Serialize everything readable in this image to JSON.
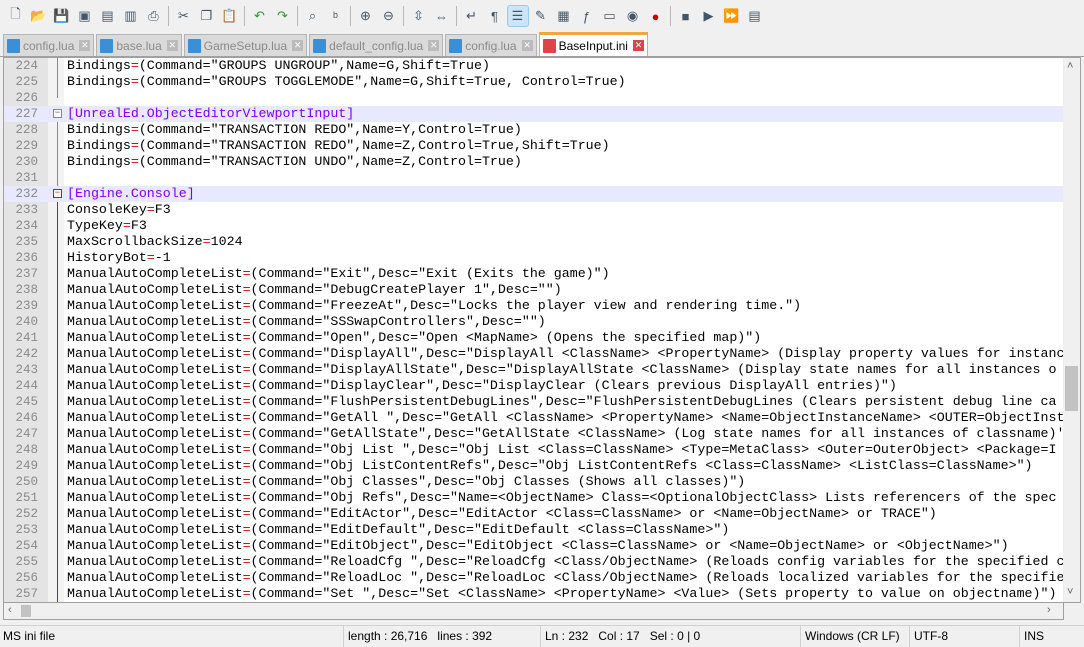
{
  "toolbar": {
    "icons": [
      "new-file",
      "open-file",
      "save",
      "save-all",
      "close",
      "close-all",
      "print",
      "cut",
      "copy",
      "paste",
      "undo",
      "redo",
      "find",
      "replace",
      "zoom-in",
      "zoom-out",
      "sync-vertical",
      "sync-horizontal",
      "word-wrap",
      "show-all-chars",
      "indent-guide",
      "user-defined-lang",
      "doc-map",
      "function-list",
      "folder-workspace",
      "monitor",
      "record-macro",
      "stop-macro",
      "play-macro",
      "run-macro-multiple",
      "save-macro"
    ]
  },
  "tabs": [
    {
      "label": "config.lua"
    },
    {
      "label": "base.lua"
    },
    {
      "label": "GameSetup.lua"
    },
    {
      "label": "default_config.lua"
    },
    {
      "label": "config.lua"
    },
    {
      "label": "BaseInput.ini",
      "active": true
    }
  ],
  "editor": {
    "lines": [
      {
        "n": "224",
        "t": "Bindings=(Command=\"GROUPS UNGROUP\",Name=G,Shift=True)"
      },
      {
        "n": "225",
        "t": "Bindings=(Command=\"GROUPS TOGGLEMODE\",Name=G,Shift=True, Control=True)"
      },
      {
        "n": "226",
        "t": ""
      },
      {
        "n": "227",
        "t": "[UnrealEd.ObjectEditorViewportInput]"
      },
      {
        "n": "228",
        "t": "Bindings=(Command=\"TRANSACTION REDO\",Name=Y,Control=True)"
      },
      {
        "n": "229",
        "t": "Bindings=(Command=\"TRANSACTION REDO\",Name=Z,Control=True,Shift=True)"
      },
      {
        "n": "230",
        "t": "Bindings=(Command=\"TRANSACTION UNDO\",Name=Z,Control=True)"
      },
      {
        "n": "231",
        "t": ""
      },
      {
        "n": "232",
        "t": "[Engine.Console]"
      },
      {
        "n": "233",
        "t": "ConsoleKey=F3"
      },
      {
        "n": "234",
        "t": "TypeKey=F3"
      },
      {
        "n": "235",
        "t": "MaxScrollbackSize=1024"
      },
      {
        "n": "236",
        "t": "HistoryBot=-1"
      },
      {
        "n": "237",
        "t": "ManualAutoCompleteList=(Command=\"Exit\",Desc=\"Exit (Exits the game)\")"
      },
      {
        "n": "238",
        "t": "ManualAutoCompleteList=(Command=\"DebugCreatePlayer 1\",Desc=\"\")"
      },
      {
        "n": "239",
        "t": "ManualAutoCompleteList=(Command=\"FreezeAt\",Desc=\"Locks the player view and rendering time.\")"
      },
      {
        "n": "240",
        "t": "ManualAutoCompleteList=(Command=\"SSSwapControllers\",Desc=\"\")"
      },
      {
        "n": "241",
        "t": "ManualAutoCompleteList=(Command=\"Open\",Desc=\"Open <MapName> (Opens the specified map)\")"
      },
      {
        "n": "242",
        "t": "ManualAutoCompleteList=(Command=\"DisplayAll\",Desc=\"DisplayAll <ClassName> <PropertyName> (Display property values for instanc"
      },
      {
        "n": "243",
        "t": "ManualAutoCompleteList=(Command=\"DisplayAllState\",Desc=\"DisplayAllState <ClassName> (Display state names for all instances o"
      },
      {
        "n": "244",
        "t": "ManualAutoCompleteList=(Command=\"DisplayClear\",Desc=\"DisplayClear (Clears previous DisplayAll entries)\")"
      },
      {
        "n": "245",
        "t": "ManualAutoCompleteList=(Command=\"FlushPersistentDebugLines\",Desc=\"FlushPersistentDebugLines (Clears persistent debug line ca"
      },
      {
        "n": "246",
        "t": "ManualAutoCompleteList=(Command=\"GetAll \",Desc=\"GetAll <ClassName> <PropertyName> <Name=ObjectInstanceName> <OUTER=ObjectInst"
      },
      {
        "n": "247",
        "t": "ManualAutoCompleteList=(Command=\"GetAllState\",Desc=\"GetAllState <ClassName> (Log state names for all instances of classname)'"
      },
      {
        "n": "248",
        "t": "ManualAutoCompleteList=(Command=\"Obj List \",Desc=\"Obj List <Class=ClassName> <Type=MetaClass> <Outer=OuterObject> <Package=I"
      },
      {
        "n": "249",
        "t": "ManualAutoCompleteList=(Command=\"Obj ListContentRefs\",Desc=\"Obj ListContentRefs <Class=ClassName> <ListClass=ClassName>\")"
      },
      {
        "n": "250",
        "t": "ManualAutoCompleteList=(Command=\"Obj Classes\",Desc=\"Obj Classes (Shows all classes)\")"
      },
      {
        "n": "251",
        "t": "ManualAutoCompleteList=(Command=\"Obj Refs\",Desc=\"Name=<ObjectName> Class=<OptionalObjectClass> Lists referencers of the spec"
      },
      {
        "n": "252",
        "t": "ManualAutoCompleteList=(Command=\"EditActor\",Desc=\"EditActor <Class=ClassName> or <Name=ObjectName> or TRACE\")"
      },
      {
        "n": "253",
        "t": "ManualAutoCompleteList=(Command=\"EditDefault\",Desc=\"EditDefault <Class=ClassName>\")"
      },
      {
        "n": "254",
        "t": "ManualAutoCompleteList=(Command=\"EditObject\",Desc=\"EditObject <Class=ClassName> or <Name=ObjectName> or <ObjectName>\")"
      },
      {
        "n": "255",
        "t": "ManualAutoCompleteList=(Command=\"ReloadCfg \",Desc=\"ReloadCfg <Class/ObjectName> (Reloads config variables for the specified c"
      },
      {
        "n": "256",
        "t": "ManualAutoCompleteList=(Command=\"ReloadLoc \",Desc=\"ReloadLoc <Class/ObjectName> (Reloads localized variables for the specifie"
      },
      {
        "n": "257",
        "t": "ManualAutoCompleteList=(Command=\"Set \",Desc=\"Set <ClassName> <PropertyName> <Value> (Sets property to value on objectname)\")"
      }
    ]
  },
  "status": {
    "file_type": "MS ini file",
    "length": "length : 26,716",
    "lines": "lines : 392",
    "ln": "Ln : 232",
    "col": "Col : 17",
    "sel": "Sel : 0 | 0",
    "eol": "Windows (CR LF)",
    "encoding": "UTF-8",
    "mode": "INS"
  }
}
